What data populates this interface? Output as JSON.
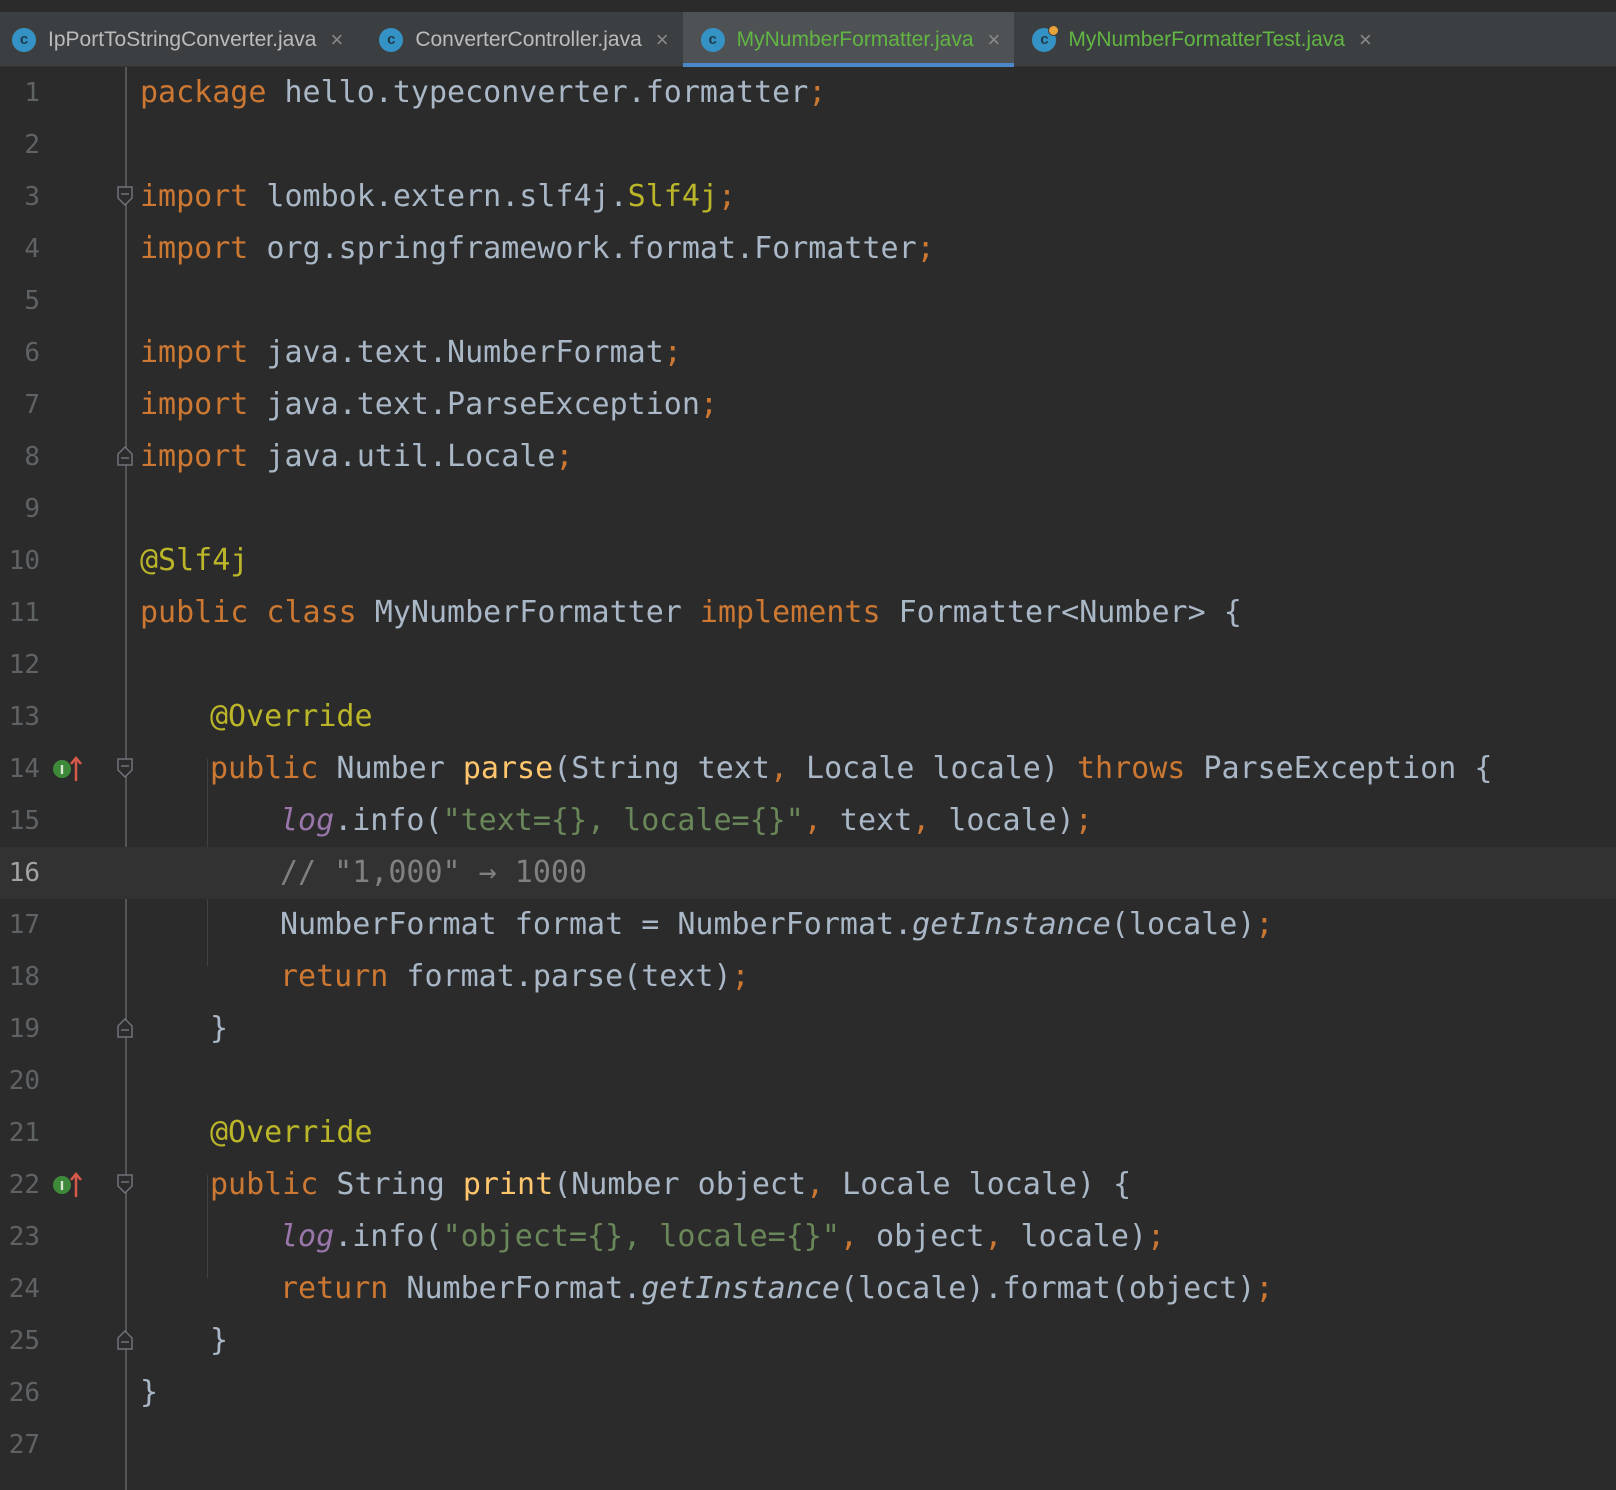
{
  "tabs": [
    {
      "label": "IpPortToStringConverter.java",
      "icon": "java-class-icon",
      "active": false
    },
    {
      "label": "ConverterController.java",
      "icon": "java-class-icon",
      "active": false
    },
    {
      "label": "MyNumberFormatter.java",
      "icon": "java-class-icon",
      "active": true
    },
    {
      "label": "MyNumberFormatterTest.java",
      "icon": "java-test-class-icon",
      "active": false
    }
  ],
  "colors": {
    "keyword": "#cc7832",
    "annotation": "#bbb529",
    "string": "#6a8759",
    "method": "#ffc66d",
    "field": "#9876aa",
    "comment": "#808080",
    "text": "#a9b7c6",
    "active_tab_underline": "#4a88c7"
  },
  "editor": {
    "current_line": 16,
    "line_numbers": [
      "1",
      "2",
      "3",
      "4",
      "5",
      "6",
      "7",
      "8",
      "9",
      "10",
      "11",
      "12",
      "13",
      "14",
      "15",
      "16",
      "17",
      "18",
      "19",
      "20",
      "21",
      "22",
      "23",
      "24",
      "25",
      "26",
      "27"
    ],
    "code": {
      "l1": [
        "package",
        " hello.typeconverter.formatter",
        ";"
      ],
      "l3": [
        "import",
        " lombok.extern.slf4j.",
        "Slf4j",
        ";"
      ],
      "l4": [
        "import",
        " org.springframework.format.Formatter",
        ";"
      ],
      "l6": [
        "import",
        " java.text.NumberFormat",
        ";"
      ],
      "l7": [
        "import",
        " java.text.ParseException",
        ";"
      ],
      "l8": [
        "import",
        " java.util.Locale",
        ";"
      ],
      "l10": [
        "@Slf4j"
      ],
      "l11": [
        "public class",
        " MyNumberFormatter ",
        "implements",
        " Formatter<Number> {"
      ],
      "l13": [
        "@Override"
      ],
      "l14": [
        "public",
        " Number ",
        "parse",
        "(String text",
        ",",
        " Locale locale) ",
        "throws",
        " ParseException {"
      ],
      "l15": [
        "log",
        ".info(",
        "\"text={}, locale={}\"",
        ",",
        " text",
        ",",
        " locale)",
        ";"
      ],
      "l16": [
        "// \"1,000\" → 1000"
      ],
      "l17": [
        "NumberFormat format = NumberFormat.",
        "getInstance",
        "(locale)",
        ";"
      ],
      "l18": [
        "return",
        " format.parse(text)",
        ";"
      ],
      "l19": [
        "}"
      ],
      "l21": [
        "@Override"
      ],
      "l22": [
        "public",
        " String ",
        "print",
        "(Number object",
        ",",
        " Locale locale) {"
      ],
      "l23": [
        "log",
        ".info(",
        "\"object={}, locale={}\"",
        ",",
        " object",
        ",",
        " locale)",
        ";"
      ],
      "l24": [
        "return",
        " NumberFormat.",
        "getInstance",
        "(locale).format(object)",
        ";"
      ],
      "l25": [
        "}"
      ],
      "l26": [
        "}"
      ]
    },
    "gutter_markers": {
      "l14": "implements-method-icon",
      "l22": "implements-method-icon"
    }
  }
}
